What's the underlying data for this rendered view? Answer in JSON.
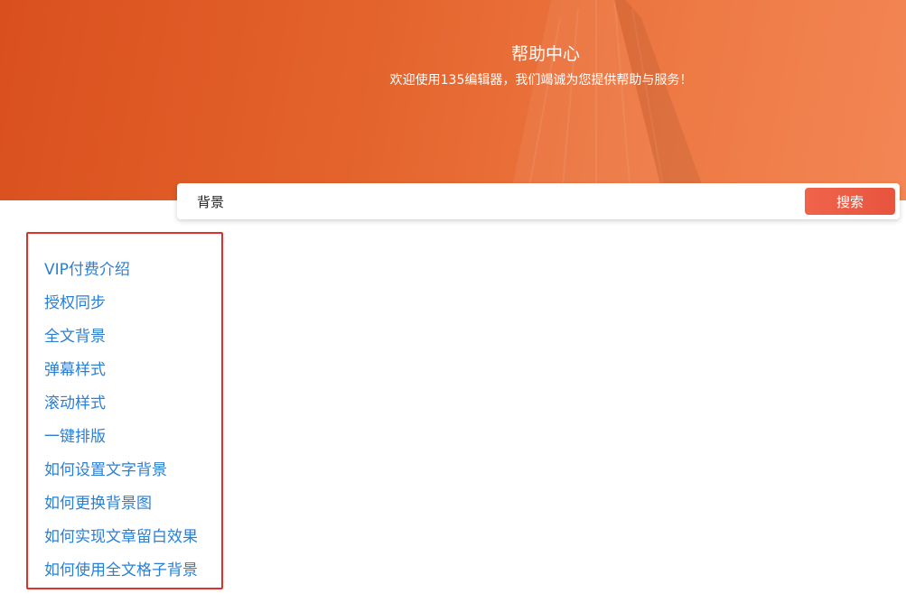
{
  "header": {
    "title": "帮助中心",
    "subtitle": "欢迎使用135编辑器，我们竭诚为您提供帮助与服务！"
  },
  "search": {
    "value": "背景",
    "button_label": "搜索"
  },
  "results": [
    "VIP付费介绍",
    "授权同步",
    "全文背景",
    "弹幕样式",
    "滚动样式",
    "一键排版",
    "如何设置文字背景",
    "如何更换背景图",
    "如何实现文章留白效果",
    "如何使用全文格子背景"
  ],
  "colors": {
    "hero_start": "#d9501e",
    "hero_end": "#f38655",
    "link": "#2a7fd4",
    "search_button": "#e8543e",
    "result_border": "#e0302a"
  }
}
